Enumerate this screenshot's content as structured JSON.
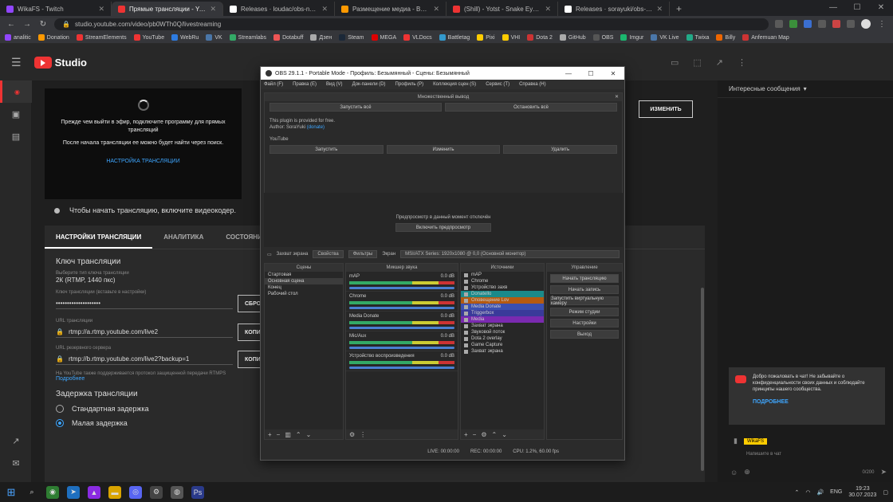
{
  "browser": {
    "tabs": [
      {
        "title": "WikaFS - Twitch",
        "color": "#9146ff",
        "active": false
      },
      {
        "title": "Прямые трансляции - YouTube Studio",
        "color": "#e33",
        "active": true
      },
      {
        "title": "Releases · loudac/obs-ngshare",
        "color": "#fff",
        "active": false
      },
      {
        "title": "Размещение медиа - Видеоmix",
        "color": "#f90",
        "active": false
      },
      {
        "title": "(Shill) - Yotst - Snake Eyes (feat",
        "color": "#e33",
        "active": false
      },
      {
        "title": "Releases · sorayuki/obs-multi-rt",
        "color": "#fff",
        "active": false
      }
    ],
    "url": "studio.youtube.com/video/pb0WTh0Q/livestreaming",
    "bookmarks": [
      "analitic",
      "Donation",
      "StreamElements",
      "YouTube",
      "WebRu",
      "VK",
      "Streamlabs",
      "Dotabuff",
      "Дзен",
      "Steam",
      "MEGA",
      "VLDocs",
      "Battletag",
      "Pixi",
      "VHI",
      "Dota 2",
      "GitHub",
      "OBS",
      "Imgur",
      "VK Live",
      "Twixa",
      "Billy",
      "Anfemuan Map"
    ]
  },
  "studio": {
    "logo": "Studio",
    "preview": {
      "line1": "Прежде чем выйти в эфир, подключите программу для прямых трансляций",
      "line2": "После начала трансляции ее можно будет найти через поиск.",
      "link": "НАСТРОЙКА ТРАНСЛЯЦИИ"
    },
    "cam_note": "Чтобы начать трансляцию, включите видеокодер.",
    "change_btn": "ИЗМЕНИТЬ",
    "tabs": [
      "НАСТРОЙКИ ТРАНСЛЯЦИИ",
      "АНАЛИТИКА",
      "СОСТОЯНИЕ"
    ],
    "settings": {
      "key_h": "Ключ трансляции",
      "key_sub": "Выберите тип ключа трансляции",
      "key_val": "2К (RTMP, 1440 пкс)",
      "key_hidden_l": "Ключ трансляции (вставьте в настройки)",
      "reset_btn": "СБРОСИТЬ",
      "copy_btn": "КОПИ",
      "url_l": "URL трансляции",
      "url": "rtmp://a.rtmp.youtube.com/live2",
      "backup_l": "URL резервного сервера",
      "backup": "rtmp://b.rtmp.youtube.com/live2?backup=1",
      "help_note": "На YouTube также поддерживается протокол защищенной передачи RTMPS",
      "help": "Подробнее",
      "delay_h": "Задержка трансляции",
      "delay_opts": [
        "Стандартная задержка",
        "Малая задержка"
      ]
    }
  },
  "chat": {
    "header": "Интересные сообщения",
    "box_text": "Добро пожаловать в чат! Не забывайте о конфиденциальности своих данных и соблюдайте принципы нашего сообщества.",
    "box_link": "ПОДРОБНЕЕ",
    "user": "WikaFS",
    "input_placeholder": "Напишите в чат",
    "count": "0/200"
  },
  "obs": {
    "title": "OBS 29.1.1 - Portable Mode - Профиль: Безымянный - Сцены: Безымянный",
    "menu": [
      "Файл (F)",
      "Правка (E)",
      "Вид (V)",
      "Док-панели (D)",
      "Профиль (P)",
      "Коллекция сцен (S)",
      "Сервис (T)",
      "Справка (H)"
    ],
    "multi_out": {
      "title": "Множественный вывод",
      "start_all": "Запустить всё",
      "stop_all": "Остановить всё",
      "plugin_text": "This plugin is provided for free.",
      "author": "Author: SoraYuki",
      "author_link": "(donate)",
      "target": "YouTube",
      "t_start": "Запустить",
      "t_edit": "Изменить",
      "t_delete": "Удалить"
    },
    "preview_text": "Предпросмотр в данный момент отключён",
    "preview_btn": "Включить предпросмотр",
    "ctx": {
      "source": "Захват экрана",
      "props": "Свойства",
      "filters": "Фильтры",
      "screen_l": "Экран",
      "screen": "MSI/ATX Series: 1920x1080 @ 0,0 (Основной монитор)"
    },
    "docks": {
      "scenes": "Сцены",
      "mixer": "Микшер звука",
      "sources": "Источники",
      "controls": "Управление"
    },
    "scenes": [
      "Стартовая",
      "Основная сцена",
      "Конец",
      "Рабочий стол"
    ],
    "mixer": [
      {
        "name": "mAP",
        "db": "0.0 dB"
      },
      {
        "name": "Chrome",
        "db": "0.0 dB"
      },
      {
        "name": "Media Donate",
        "db": "0.0 dB"
      },
      {
        "name": "Mic/Aux",
        "db": "0.0 dB"
      },
      {
        "name": "Устройство воспроизведения",
        "db": "0.0 dB"
      }
    ],
    "sources": [
      "mAP",
      "Chrome",
      "Устройство захв",
      "Donatello",
      "Оповещение Lov",
      "Media Donate",
      "Triggerbox",
      "Media",
      "Захват экрана",
      "Звуковой поток",
      "Dota 2 overlay",
      "Game Capture",
      "Захват экрана"
    ],
    "source_colors": [
      "",
      "",
      "",
      "#1a8a8a",
      "#b55a10",
      "#3a4fb0",
      "#3a3a9a",
      "#7a2ab0",
      "",
      "",
      "",
      "",
      ""
    ],
    "controls": [
      "Начать трансляцию",
      "Начать запись",
      "Запустить виртуальную камеру",
      "Режим студии",
      "Настройки",
      "Выход"
    ],
    "status": {
      "live": "LIVE: 00:00:00",
      "rec": "REC: 00:00:00",
      "cpu": "CPU: 1.2%, 60.00 fps"
    }
  },
  "taskbar": {
    "lang": "ENG",
    "time": "19:23",
    "date": "30.07.2023"
  }
}
